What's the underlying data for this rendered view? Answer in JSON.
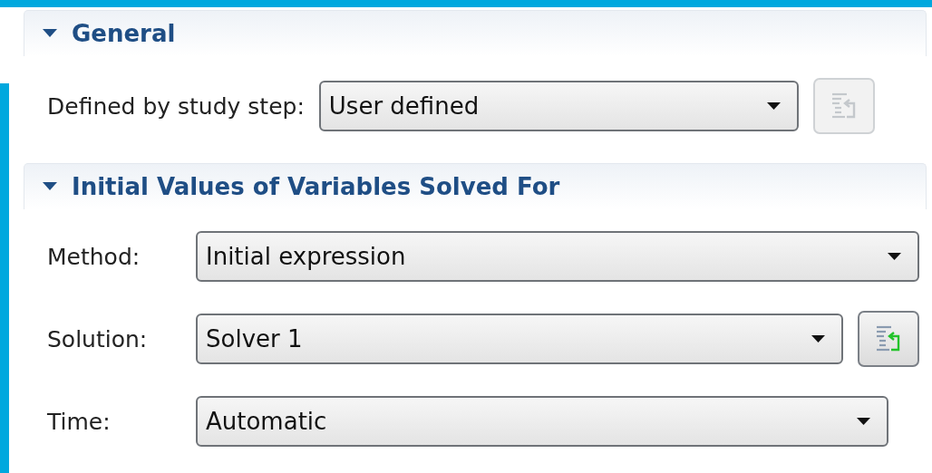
{
  "sections": [
    {
      "title": "General",
      "expanded": true,
      "rows": [
        {
          "label": "Defined by study step:",
          "value": "User defined",
          "button": {
            "disabled": true
          }
        }
      ]
    },
    {
      "title": "Initial Values of Variables Solved For",
      "expanded": true,
      "rows": [
        {
          "label": "Method:",
          "value": "Initial expression"
        },
        {
          "label": "Solution:",
          "value": "Solver 1",
          "button": {
            "disabled": false
          }
        },
        {
          "label": "Time:",
          "value": "Automatic"
        }
      ]
    }
  ]
}
